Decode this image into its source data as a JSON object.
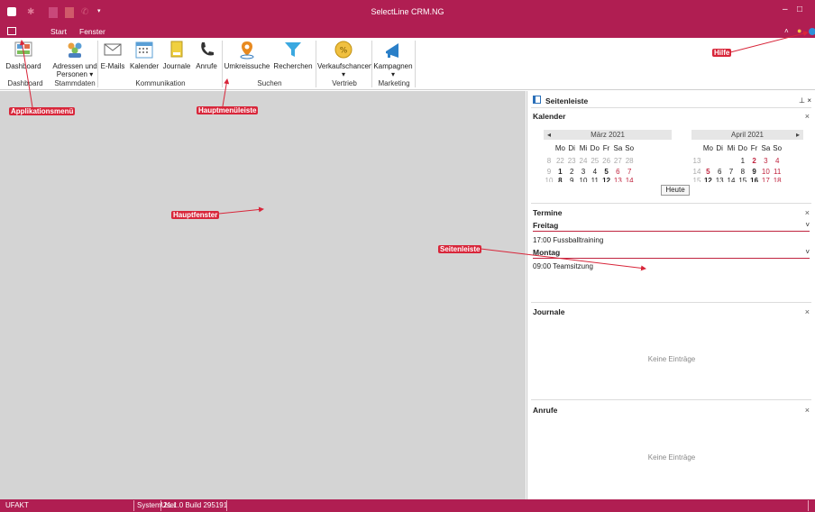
{
  "window": {
    "title": "SelectLine CRM.NG",
    "minimize": "–",
    "maximize": "□"
  },
  "menu": {
    "tabs": [
      "Start",
      "Fenster"
    ]
  },
  "ribbon": {
    "buttons": {
      "dashboard": "Dashboard",
      "adressen": "Adressen und",
      "adressen2": "Personen ▾",
      "emails": "E-Mails",
      "kalender": "Kalender",
      "journale": "Journale",
      "anrufe": "Anrufe",
      "umkreis": "Umkreissuche",
      "recherchen": "Recherchen",
      "verkauf": "Verkaufschancen",
      "verkauf_arrow": "▾",
      "kampagnen": "Kampagnen",
      "kampagnen_arrow": "▾"
    },
    "groups": {
      "dashboard": "Dashboard",
      "stammdaten": "Stammdaten",
      "kommunikation": "Kommunikation",
      "suchen": "Suchen",
      "vertrieb": "Vertrieb",
      "marketing": "Marketing"
    }
  },
  "sidebar": {
    "title": "Seitenleiste",
    "pin": "⊥ ×",
    "kalender": {
      "title": "Kalender",
      "left_month": "März 2021",
      "right_month": "April 2021",
      "prev": "◂",
      "next": "▸",
      "weekdays": [
        "Mo",
        "Di",
        "Mi",
        "Do",
        "Fr",
        "Sa",
        "So"
      ],
      "today_button": "Heute"
    },
    "termine": {
      "title": "Termine",
      "days": [
        {
          "label": "Freitag",
          "entry": "17:00 Fussballtraining"
        },
        {
          "label": "Montag",
          "entry": "09:00 Teamsitzung"
        }
      ]
    },
    "journale": {
      "title": "Journale",
      "empty": "Keine Einträge"
    },
    "anrufe": {
      "title": "Anrufe",
      "empty": "Keine Einträge"
    },
    "close": "×"
  },
  "statusbar": {
    "app": "UFAKT",
    "user": "SystemUser",
    "version": "21.1.0 Build 295191"
  },
  "annotations": {
    "appmenu": "Applikationsmenü",
    "mainmenu": "Hauptmenüleiste",
    "mainwindow": "Hauptfenster",
    "sidebar": "Seitenleiste",
    "help": "Hilfe"
  },
  "colors": {
    "brand": "#b01e52",
    "annotation": "#d8263a"
  }
}
